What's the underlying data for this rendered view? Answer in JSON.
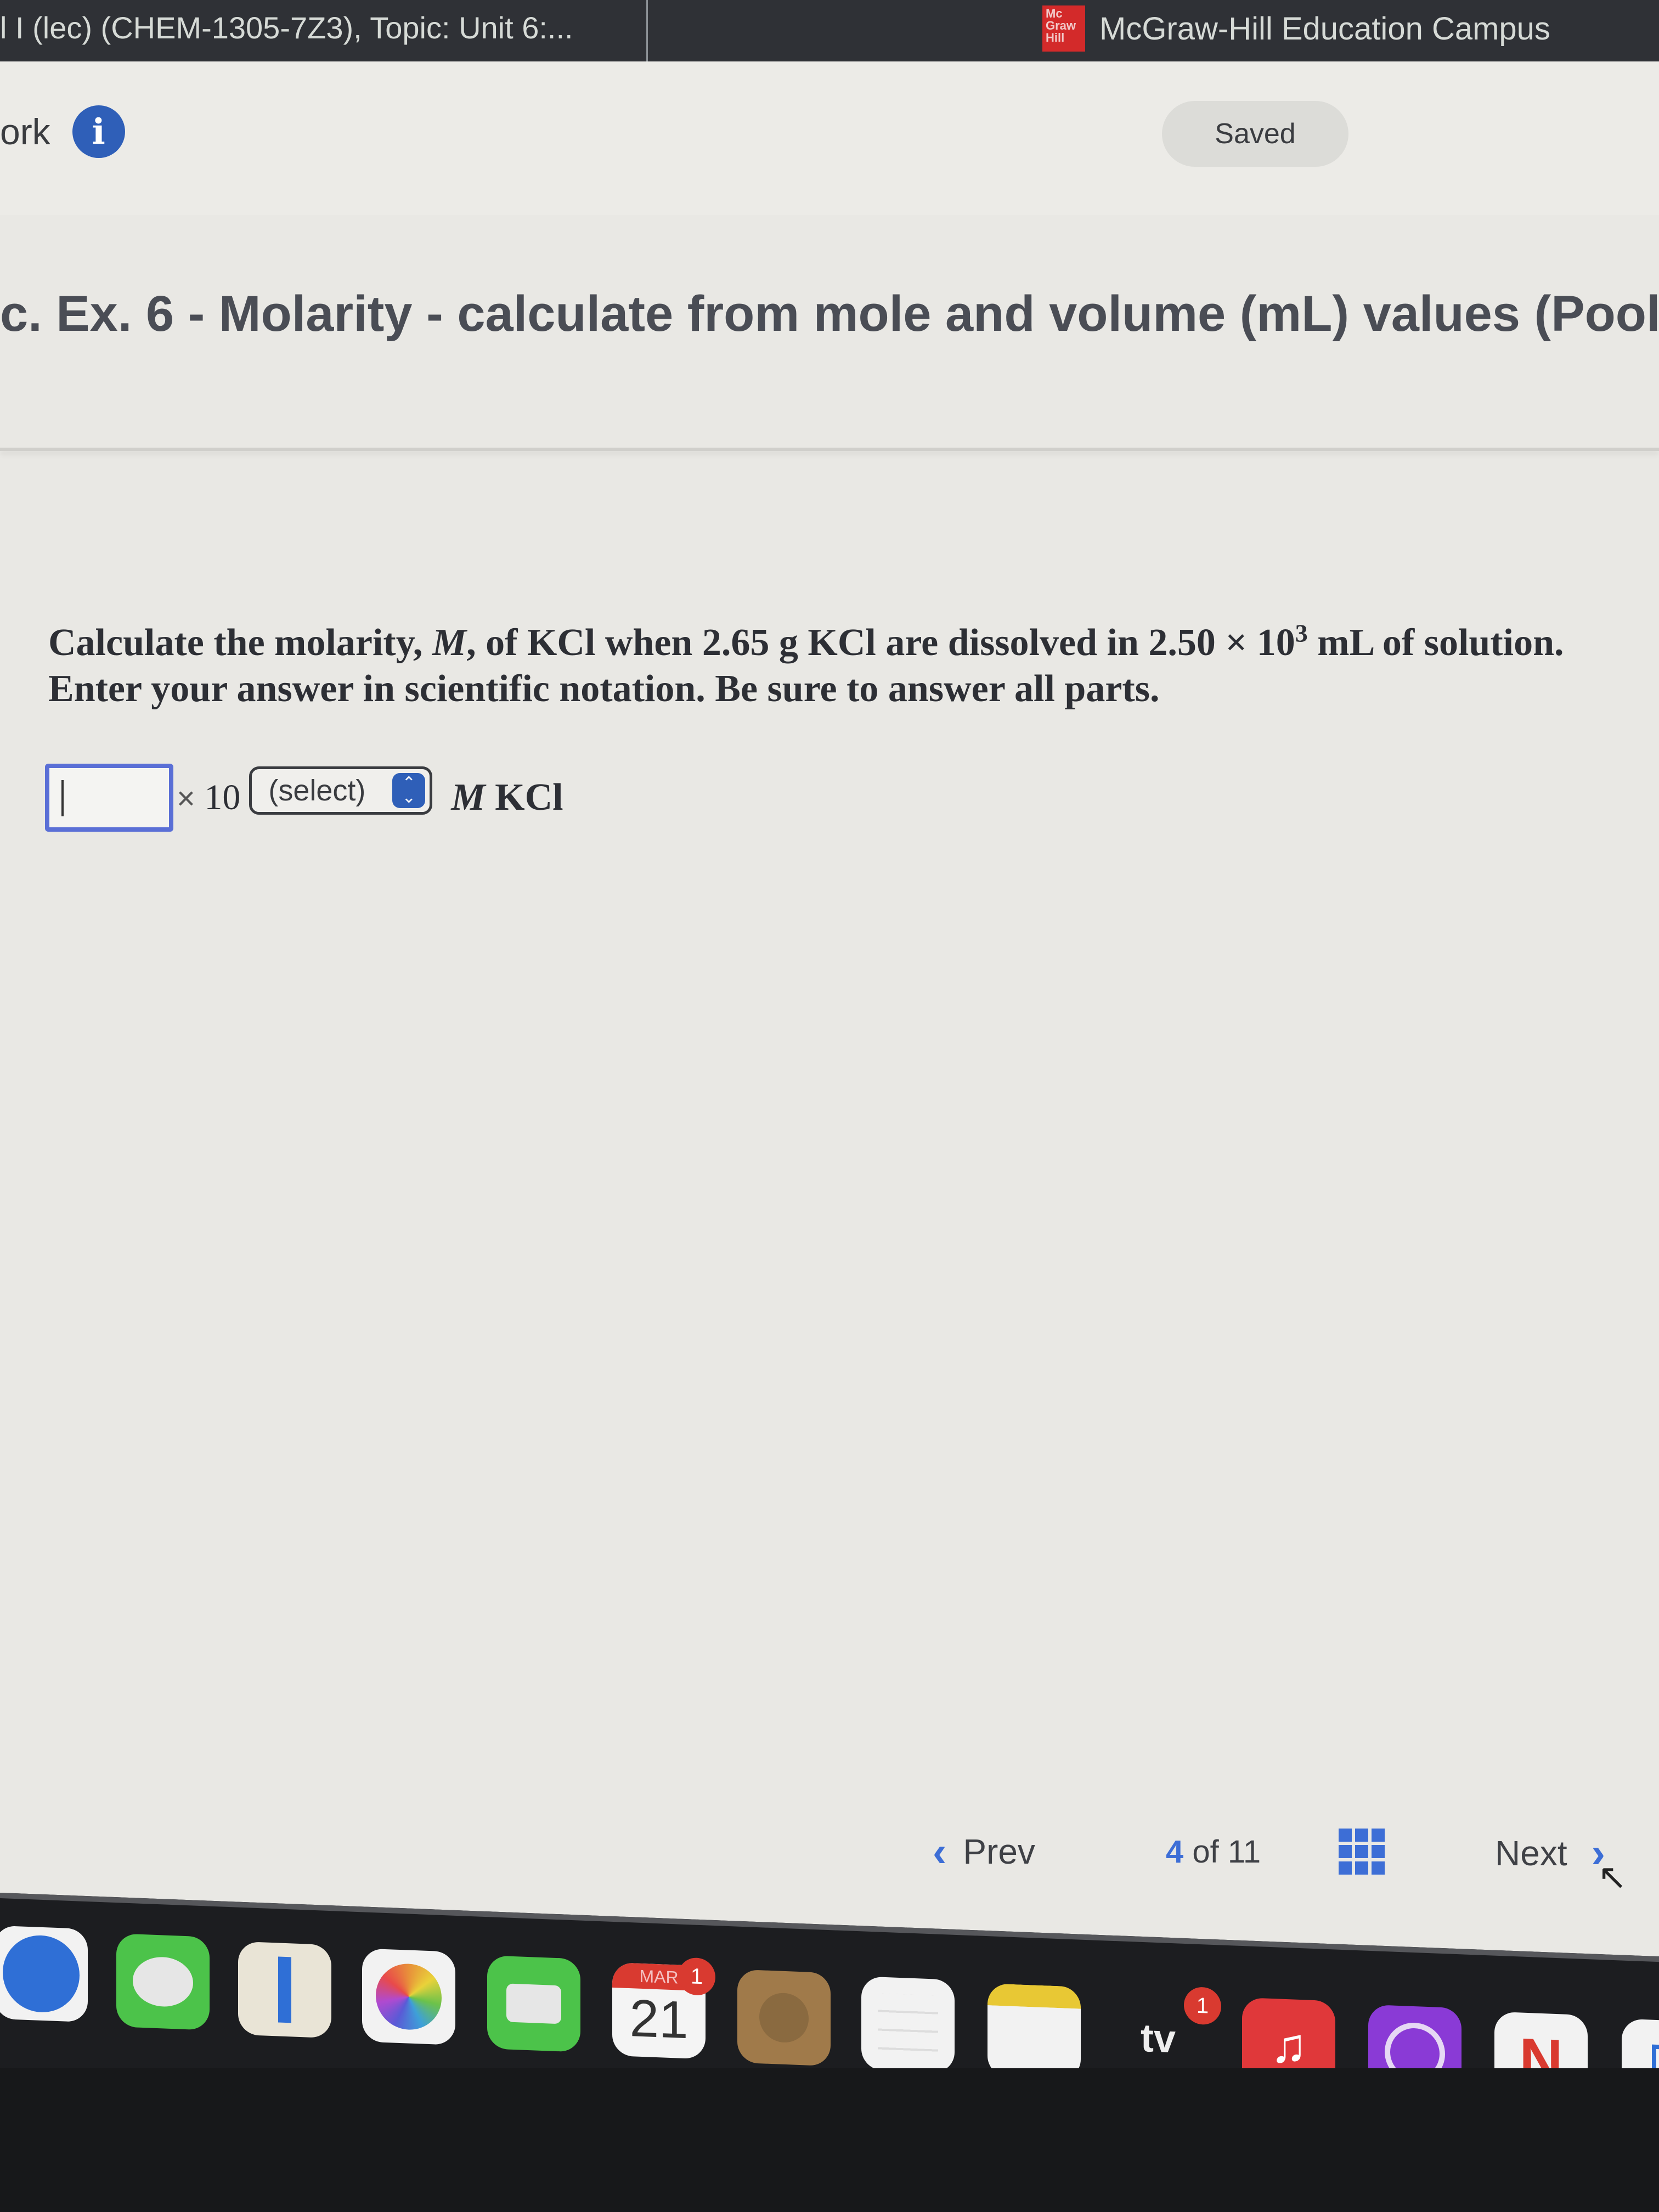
{
  "header": {
    "course_title": "l I (lec) (CHEM-1305-7Z3), Topic: Unit 6:...",
    "brand_logo_text": "Mc Graw Hill",
    "brand_name": "McGraw-Hill Education Campus"
  },
  "subheader": {
    "section_label": "ork",
    "info_icon": "i",
    "status": "Saved"
  },
  "question": {
    "title": "c. Ex. 6 - Molarity - calculate from mole and volume (mL) values (Pool",
    "text_line1_a": "Calculate the molarity, ",
    "text_line1_var": "M",
    "text_line1_b": ", of KCl when 2.65 g KCl are dissolved in 2.50 × 10",
    "text_line1_exp": "3",
    "text_line1_c": " mL of solution.",
    "text_line2": "Enter your answer in scientific notation. Be sure to answer all parts.",
    "answer": {
      "coefficient_value": "",
      "times_symbol": "×",
      "base": "10",
      "exponent_select": "(select)",
      "unit_var": "M",
      "unit_text": "KCl"
    }
  },
  "navigation": {
    "prev_label": "Prev",
    "current_page": "4",
    "of_label": "of",
    "total_pages": "11",
    "next_label": "Next"
  },
  "dock": {
    "apps": [
      {
        "name": "Safari",
        "icon": "compass-icon"
      },
      {
        "name": "Messages",
        "icon": "speech-bubble-icon"
      },
      {
        "name": "Maps",
        "icon": "map-icon"
      },
      {
        "name": "Photos",
        "icon": "flower-icon"
      },
      {
        "name": "FaceTime",
        "icon": "video-camera-icon"
      },
      {
        "name": "Calendar",
        "icon": "calendar-icon",
        "month": "MAR",
        "day": "21",
        "badge": "1"
      },
      {
        "name": "Contacts",
        "icon": "contacts-icon"
      },
      {
        "name": "Reminders",
        "icon": "list-icon"
      },
      {
        "name": "Notes",
        "icon": "notes-icon"
      },
      {
        "name": "TV",
        "icon": "tv-icon",
        "label": "tv",
        "badge": "1"
      },
      {
        "name": "Music",
        "icon": "music-note-icon"
      },
      {
        "name": "Podcasts",
        "icon": "podcast-icon"
      },
      {
        "name": "News",
        "icon": "news-icon"
      },
      {
        "name": "Keynote",
        "icon": "keynote-icon"
      }
    ]
  },
  "colors": {
    "accent_blue": "#3d6ed6",
    "input_border": "#5a6fd6",
    "header_bg": "#2f3136",
    "brand_red": "#d32a2a"
  }
}
